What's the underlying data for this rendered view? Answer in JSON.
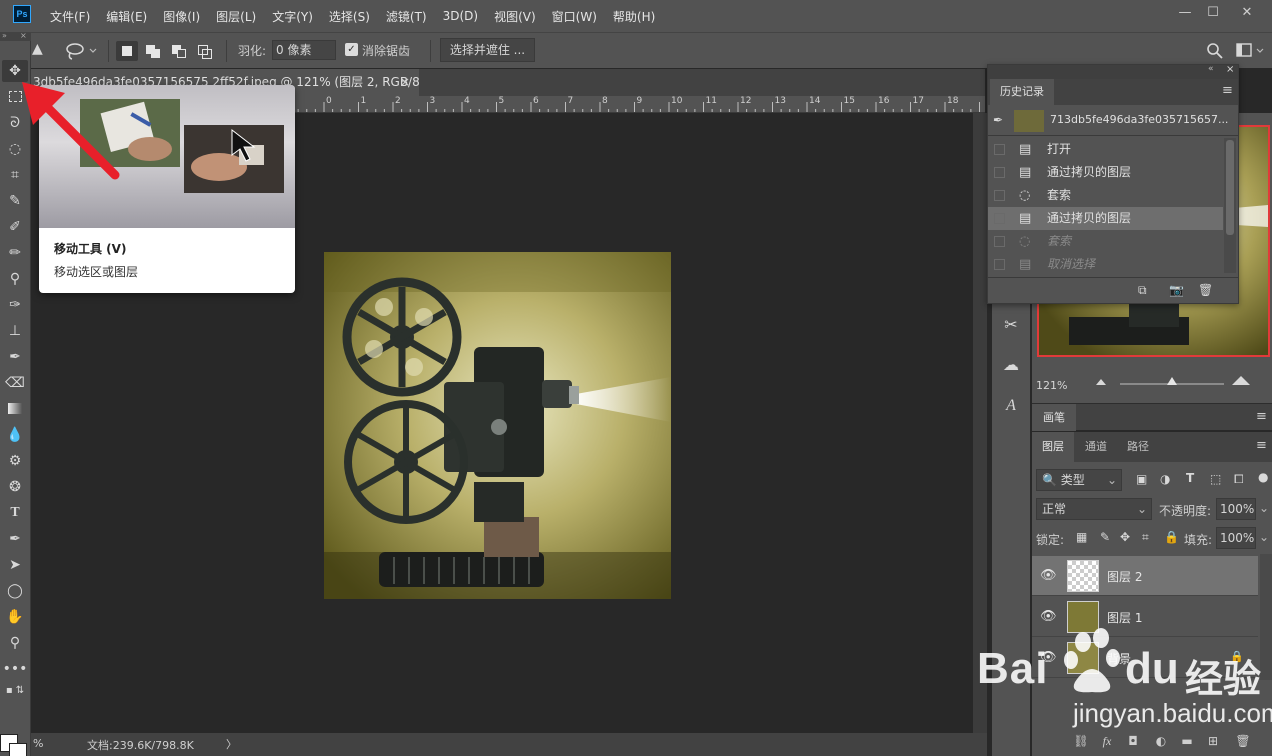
{
  "app": {
    "logo": "Ps",
    "menus": [
      "文件(F)",
      "编辑(E)",
      "图像(I)",
      "图层(L)",
      "文字(Y)",
      "选择(S)",
      "滤镜(T)",
      "3D(D)",
      "视图(V)",
      "窗口(W)",
      "帮助(H)"
    ],
    "window_controls": {
      "minimize": "—",
      "restore": "☐",
      "close": "✕"
    }
  },
  "options_bar": {
    "feather_label": "羽化:",
    "feather_value": "0 像素",
    "antialias_checked": "✓",
    "antialias_label": "消除锯齿",
    "select_mask_label": "选择并遮住 ..."
  },
  "document": {
    "tab_title": "3db5fe496da3fe0357156575 2ff52f.jpeg @ 121% (图层 2, RGB/8#) *",
    "tab_close": "×",
    "ruler_ticks": [
      "0",
      "1",
      "2",
      "3",
      "4",
      "5",
      "6",
      "7",
      "8",
      "9",
      "10",
      "11",
      "12",
      "13",
      "14",
      "15",
      "16",
      "17",
      "18"
    ],
    "status_zoom": "%",
    "status_doc": "文档:239.6K/798.8K",
    "status_arrow": "〉"
  },
  "tooltip": {
    "title": "移动工具 (V)",
    "description": "移动选区或图层"
  },
  "history": {
    "tab_label": "历史记录",
    "snapshot_name": "713db5fe496da3fe035715657...",
    "items": [
      {
        "label": "打开",
        "icon": "document-icon",
        "state": "normal"
      },
      {
        "label": "通过拷贝的图层",
        "icon": "document-icon",
        "state": "normal"
      },
      {
        "label": "套索",
        "icon": "lasso-icon",
        "state": "normal"
      },
      {
        "label": "通过拷贝的图层",
        "icon": "document-icon",
        "state": "selected"
      },
      {
        "label": "套索",
        "icon": "lasso-icon",
        "state": "dimmed"
      },
      {
        "label": "取消选择",
        "icon": "document-icon",
        "state": "dimmed"
      }
    ]
  },
  "navigator": {
    "zoom": "121%"
  },
  "brush_panel": {
    "tab_label": "画笔"
  },
  "layers_panel": {
    "tabs": [
      "图层",
      "通道",
      "路径"
    ],
    "filter_label": "类型",
    "blend_mode": "正常",
    "opacity_label": "不透明度:",
    "opacity_value": "100%",
    "lock_label": "锁定:",
    "fill_label": "填充:",
    "fill_value": "100%",
    "layers": [
      {
        "name": "图层 2",
        "visible": true,
        "selected": true,
        "locked": false
      },
      {
        "name": "图层 1",
        "visible": true,
        "selected": false,
        "locked": false
      },
      {
        "name": "背景",
        "visible": true,
        "selected": false,
        "locked": true
      }
    ]
  },
  "watermark": {
    "brand": "Bai",
    "brand_tail": "du",
    "cn": "经验",
    "url": "jingyan.baidu.com"
  },
  "colors": {
    "chrome": "#535353",
    "canvas_bg": "#282828",
    "annotation_red": "#e8202a",
    "nav_frame": "#e23a3a"
  }
}
